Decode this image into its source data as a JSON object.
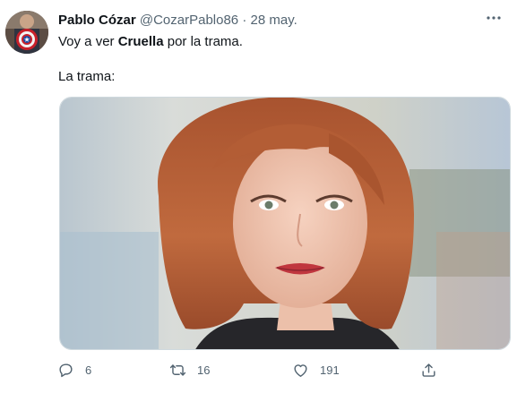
{
  "tweet": {
    "author_name": "Pablo Cózar",
    "handle": "@CozarPablo86",
    "separator": "·",
    "date": "28 may.",
    "text_before": "Voy a ver ",
    "text_bold": "Cruella",
    "text_after": " por la trama.",
    "text_line2": "La trama:",
    "media_description": "portrait photo of a woman with auburn bob hair and red lipstick"
  },
  "actions": {
    "reply_count": "6",
    "retweet_count": "16",
    "like_count": "191"
  },
  "colors": {
    "text": "#0f1419",
    "secondary": "#536471",
    "border": "#cfd9de",
    "hair": "#b45c35",
    "lips": "#c0363e"
  },
  "icons": [
    "more-icon",
    "reply-icon",
    "retweet-icon",
    "like-icon",
    "share-icon"
  ]
}
